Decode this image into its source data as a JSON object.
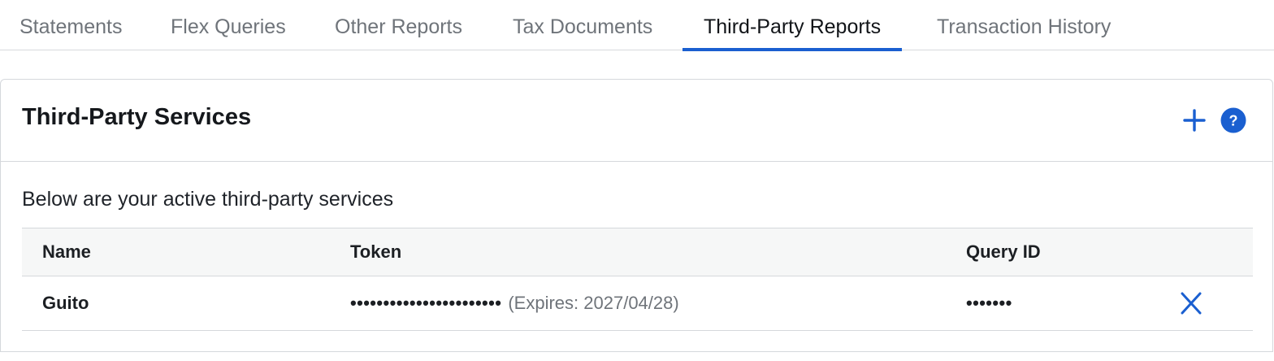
{
  "tabs": [
    {
      "label": "Statements",
      "active": false
    },
    {
      "label": "Flex Queries",
      "active": false
    },
    {
      "label": "Other Reports",
      "active": false
    },
    {
      "label": "Tax Documents",
      "active": false
    },
    {
      "label": "Third-Party Reports",
      "active": true
    },
    {
      "label": "Transaction History",
      "active": false
    }
  ],
  "panel": {
    "title": "Third-Party Services",
    "subtitle": "Below are your active third-party services",
    "actions": {
      "add_icon": "plus-icon",
      "help_icon": "question-circle-icon",
      "help_glyph": "?"
    }
  },
  "table": {
    "columns": [
      "Name",
      "Token",
      "Query ID"
    ],
    "rows": [
      {
        "name": "Guito",
        "token_masked": "•••••••••••••••••••••••",
        "expires": "(Expires: 2027/04/28)",
        "query_id_masked": "•••••••",
        "delete_icon": "close-icon"
      }
    ]
  },
  "colors": {
    "accent": "#1a5fd0",
    "muted_text": "#6f747a",
    "border": "#d5d8dc",
    "header_bg": "#f6f7f7"
  }
}
